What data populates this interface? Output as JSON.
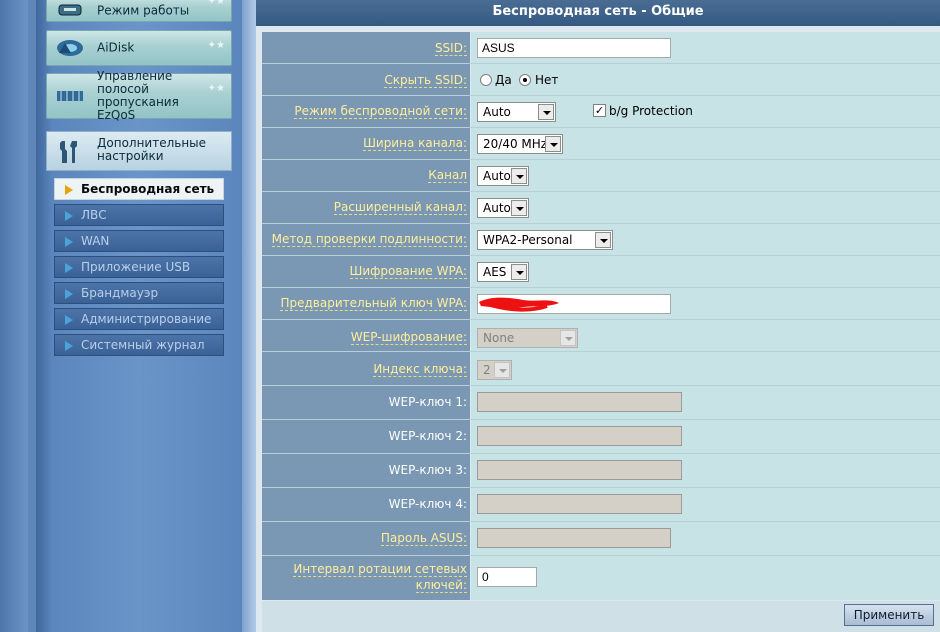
{
  "sidebar": {
    "buttons": [
      {
        "label": "Режим работы",
        "icon": "mode-icon"
      },
      {
        "label": "AiDisk",
        "icon": "disk-icon"
      },
      {
        "label": "Управление полосой пропускания EzQoS",
        "icon": "bandwidth-icon"
      }
    ],
    "submenu_title": "Дополнительные настройки",
    "items": [
      {
        "label": "Беспроводная сеть",
        "active": true
      },
      {
        "label": "ЛВС"
      },
      {
        "label": "WAN"
      },
      {
        "label": "Приложение USB"
      },
      {
        "label": "Брандмауэр"
      },
      {
        "label": "Администрирование"
      },
      {
        "label": "Системный журнал"
      }
    ]
  },
  "page_title": "Беспроводная сеть - Общие",
  "form": {
    "ssid": {
      "label": "SSID:",
      "value": "ASUS"
    },
    "hide_ssid": {
      "label": "Скрыть SSID:",
      "yes": "Да",
      "no": "Нет",
      "selected": "no"
    },
    "wireless_mode": {
      "label": "Режим беспроводной сети:",
      "value": "Auto",
      "protection_label": "b/g Protection",
      "protection_checked": true
    },
    "channel_width": {
      "label": "Ширина канала:",
      "value": "20/40 MHz"
    },
    "channel": {
      "label": "Канал",
      "value": "Auto"
    },
    "ext_channel": {
      "label": "Расширенный канал:",
      "value": "Auto"
    },
    "auth_method": {
      "label": "Метод проверки подлинности:",
      "value": "WPA2-Personal"
    },
    "wpa_encryption": {
      "label": "Шифрование WPA:",
      "value": "AES"
    },
    "wpa_key": {
      "label": "Предварительный ключ WPA:",
      "value": ""
    },
    "wep_encryption": {
      "label": "WEP-шифрование:",
      "value": "None"
    },
    "key_index": {
      "label": "Индекс ключа:",
      "value": "2"
    },
    "wep_key1": {
      "label": "WEP-ключ 1:",
      "value": ""
    },
    "wep_key2": {
      "label": "WEP-ключ 2:",
      "value": ""
    },
    "wep_key3": {
      "label": "WEP-ключ 3:",
      "value": ""
    },
    "wep_key4": {
      "label": "WEP-ключ 4:",
      "value": ""
    },
    "asus_passphrase": {
      "label": "Пароль ASUS:",
      "value": ""
    },
    "key_rotation": {
      "label_line1": "Интервал ротации сетевых",
      "label_line2": "ключей:",
      "value": "0"
    }
  },
  "apply_label": "Применить",
  "colors": {
    "label_column": "#7a97b4",
    "value_column": "#c7e3e6",
    "help_text": "#ffee9a",
    "title_bar": "#3d628b"
  }
}
